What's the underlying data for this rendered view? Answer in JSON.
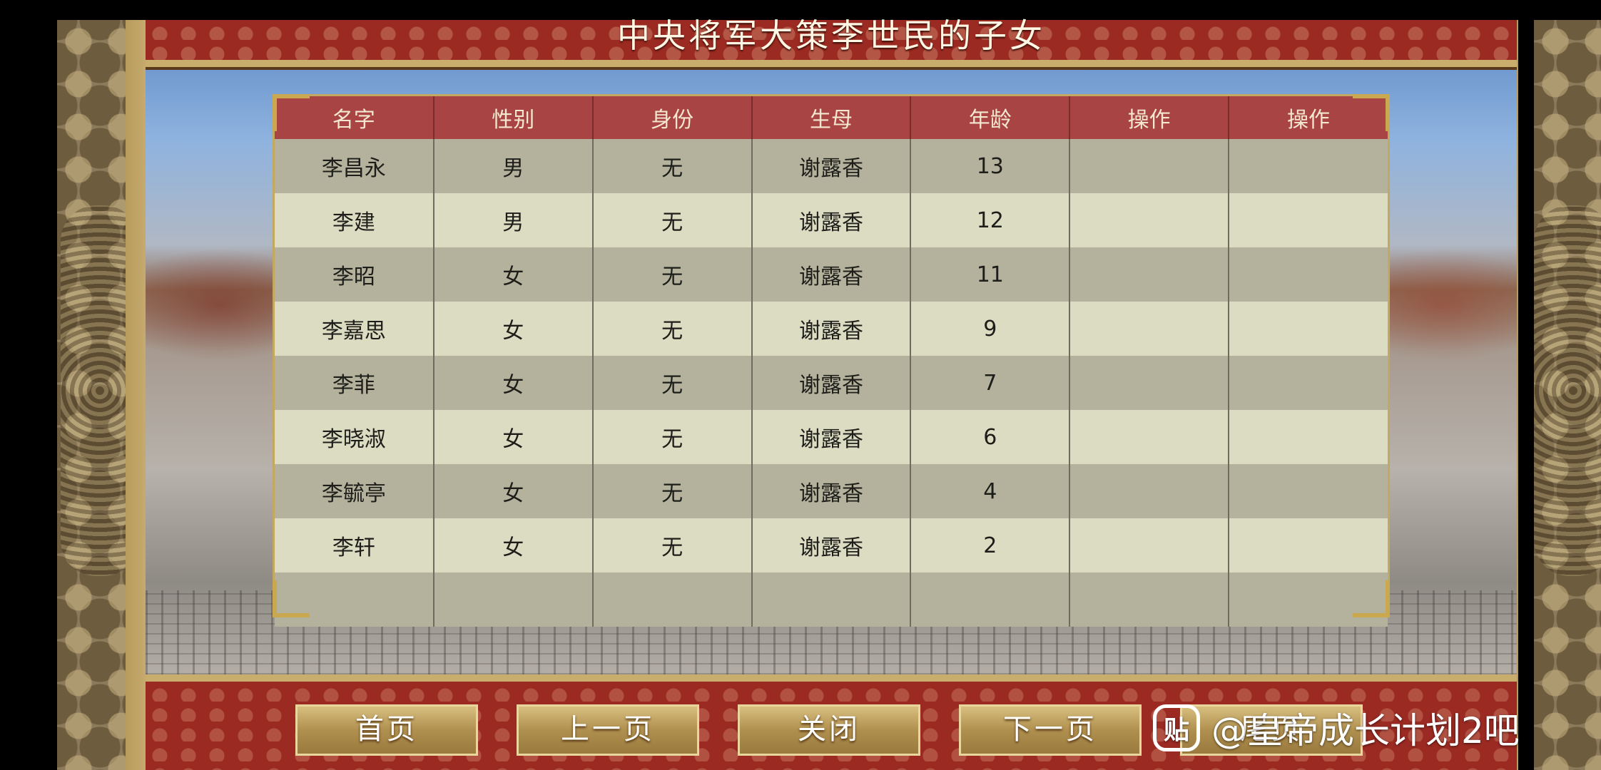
{
  "page": {
    "title": "中央将军大策李世民的子女"
  },
  "table": {
    "headers": [
      "名字",
      "性别",
      "身份",
      "生母",
      "年龄",
      "操作",
      "操作"
    ],
    "rows": [
      {
        "name": "李昌永",
        "gender": "男",
        "status": "无",
        "mother": "谢露香",
        "age": "13"
      },
      {
        "name": "李建",
        "gender": "男",
        "status": "无",
        "mother": "谢露香",
        "age": "12"
      },
      {
        "name": "李昭",
        "gender": "女",
        "status": "无",
        "mother": "谢露香",
        "age": "11"
      },
      {
        "name": "李嘉思",
        "gender": "女",
        "status": "无",
        "mother": "谢露香",
        "age": "9"
      },
      {
        "name": "李菲",
        "gender": "女",
        "status": "无",
        "mother": "谢露香",
        "age": "7"
      },
      {
        "name": "李晓淑",
        "gender": "女",
        "status": "无",
        "mother": "谢露香",
        "age": "6"
      },
      {
        "name": "李毓亭",
        "gender": "女",
        "status": "无",
        "mother": "谢露香",
        "age": "4"
      },
      {
        "name": "李轩",
        "gender": "女",
        "status": "无",
        "mother": "谢露香",
        "age": "2"
      }
    ]
  },
  "nav": {
    "first": "首页",
    "prev": "上一页",
    "close": "关闭",
    "next": "下一页",
    "last": "尾页"
  },
  "watermark": {
    "icon": "贴",
    "text": "@皇帝成长计划2吧"
  },
  "colors": {
    "header_red": "#a84444",
    "row_dark": "#b4b29c",
    "row_light": "#dcdcc2",
    "gold": "#c9ad6d"
  }
}
